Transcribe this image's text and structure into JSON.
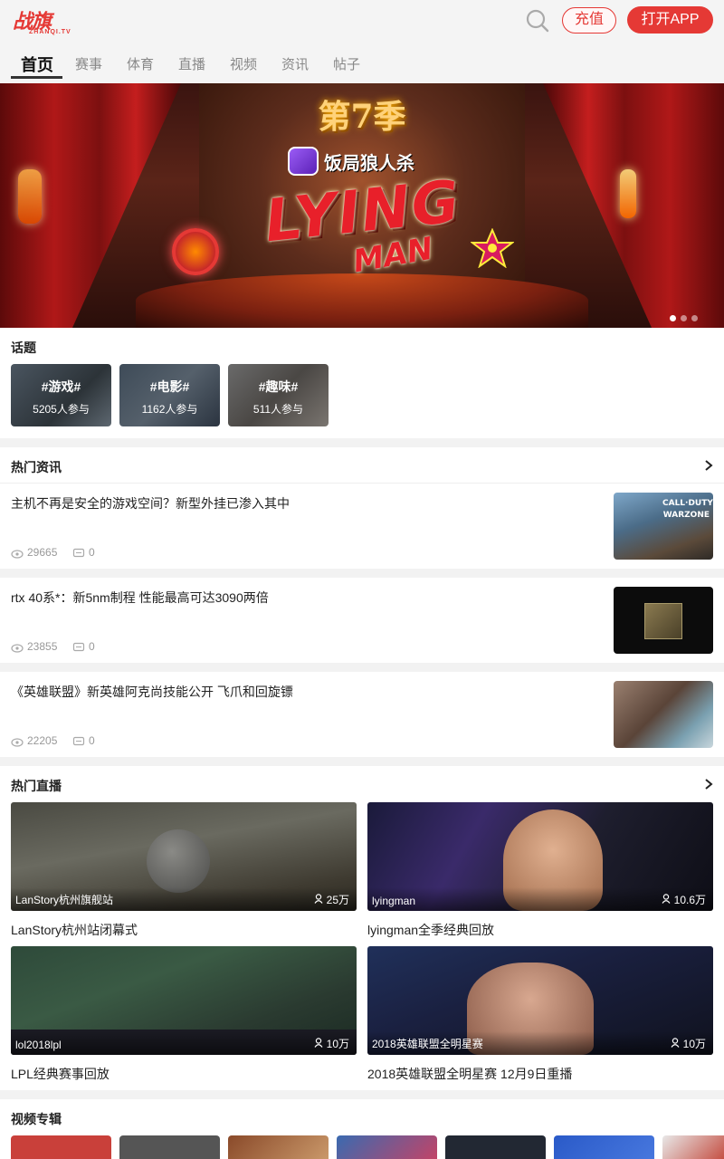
{
  "header": {
    "logo_text": "战旗",
    "logo_sub": "ZHANQI.TV",
    "recharge_label": "充值",
    "open_app_label": "打开APP"
  },
  "nav": {
    "items": [
      "首页",
      "赛事",
      "体育",
      "直播",
      "视频",
      "资讯",
      "帖子"
    ],
    "active_index": 0
  },
  "banner": {
    "season_text": "第7季",
    "game_name": "饭局狼人杀",
    "marquee_text": "LYING",
    "marquee_sub": "MAN",
    "slide_count": 3,
    "active_slide": 0
  },
  "topics": {
    "title": "话题",
    "items": [
      {
        "name": "#游戏#",
        "count": "5205人参与"
      },
      {
        "name": "#电影#",
        "count": "1162人参与"
      },
      {
        "name": "#趣味#",
        "count": "511人参与"
      }
    ]
  },
  "hot_news": {
    "title": "热门资讯",
    "items": [
      {
        "title": "主机不再是安全的游戏空间？新型外挂已渗入其中",
        "views": "29665",
        "comments": "0",
        "thumb_text": "CALL·DUTY WARZONE"
      },
      {
        "title": "rtx 40系*：新5nm制程 性能最高可达3090两倍",
        "views": "23855",
        "comments": "0"
      },
      {
        "title": "《英雄联盟》新英雄阿克尚技能公开 飞爪和回旋镖",
        "views": "22205",
        "comments": "0"
      }
    ]
  },
  "hot_live": {
    "title": "热门直播",
    "items": [
      {
        "anchor": "LanStory杭州旗舰站",
        "viewers": "25万",
        "title": "LanStory杭州站闭幕式"
      },
      {
        "anchor": "lyingman",
        "viewers": "10.6万",
        "title": "lyingman全季经典回放"
      },
      {
        "anchor": "lol2018lpl",
        "viewers": "10万",
        "title": "LPL经典赛事回放"
      },
      {
        "anchor": "2018英雄联盟全明星赛",
        "viewers": "10万",
        "title": "2018英雄联盟全明星赛 12月9日重播"
      }
    ]
  },
  "video_albums": {
    "title": "视频专辑"
  }
}
